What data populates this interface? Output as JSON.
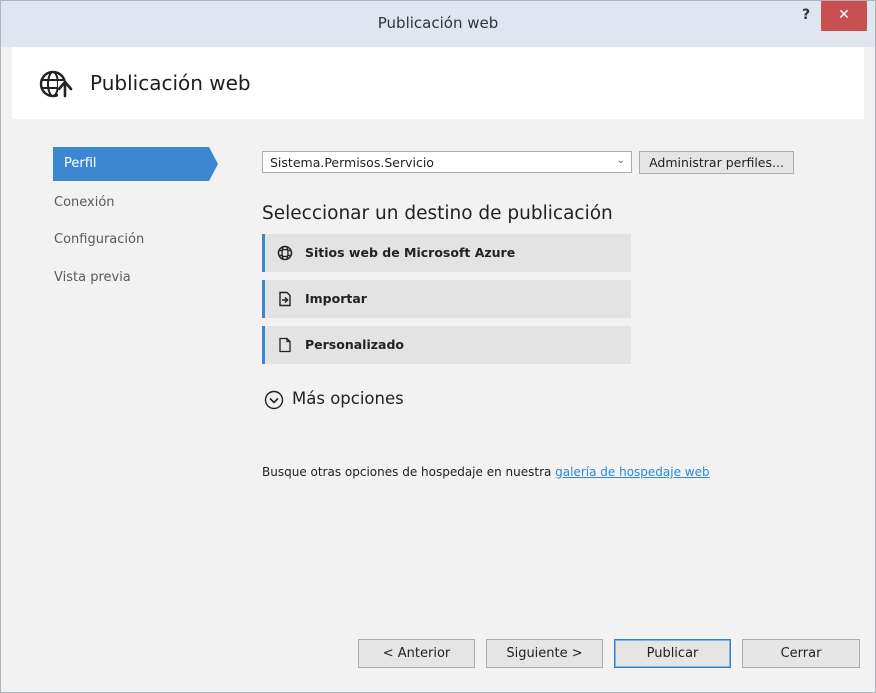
{
  "window": {
    "title": "Publicación web",
    "help_label": "?",
    "close_label": "✕"
  },
  "header": {
    "title": "Publicación web",
    "icon": "globe-publish-icon"
  },
  "nav": {
    "items": [
      {
        "label": "Perfil",
        "active": true
      },
      {
        "label": "Conexión",
        "active": false
      },
      {
        "label": "Configuración",
        "active": false
      },
      {
        "label": "Vista previa",
        "active": false
      }
    ]
  },
  "profile": {
    "selected": "Sistema.Permisos.Servicio",
    "manage_label": "Administrar perfiles..."
  },
  "main": {
    "section_title": "Seleccionar un destino de publicación",
    "targets": [
      {
        "label": "Sitios web de Microsoft Azure",
        "icon": "azure-icon"
      },
      {
        "label": "Importar",
        "icon": "import-icon"
      },
      {
        "label": "Personalizado",
        "icon": "document-icon"
      }
    ],
    "more_options_label": "Más opciones",
    "hosting_text": "Busque otras opciones de hospedaje en nuestra ",
    "hosting_link": "galería de hospedaje web"
  },
  "footer": {
    "back_label": "< Anterior",
    "next_label": "Siguiente >",
    "publish_label": "Publicar",
    "close_label": "Cerrar"
  },
  "colors": {
    "accent": "#3b88d0",
    "close_button": "#c75050",
    "link": "#2a8ad4"
  }
}
